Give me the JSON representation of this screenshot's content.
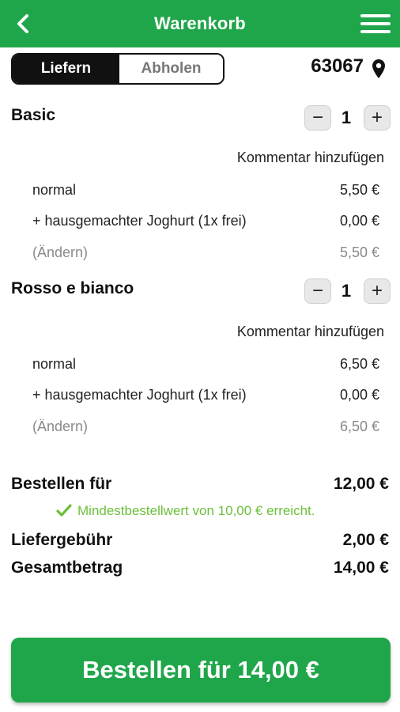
{
  "header": {
    "title": "Warenkorb",
    "back_icon": "chevron-left-icon",
    "menu_icon": "hamburger-menu-icon"
  },
  "mode": {
    "deliver_label": "Liefern",
    "pickup_label": "Abholen",
    "selected": "Liefern"
  },
  "location": {
    "zip": "63067",
    "icon": "location-pin-icon"
  },
  "items": [
    {
      "name": "Basic",
      "quantity": "1",
      "comment_label": "Kommentar hinzufügen",
      "rows": [
        {
          "label": "normal",
          "price": "5,50 €"
        },
        {
          "label": "+ hausgemachter Joghurt (1x frei)",
          "price": "0,00 €"
        },
        {
          "label": "(Ändern)",
          "price": "5,50 €"
        }
      ]
    },
    {
      "name": "Rosso e bianco",
      "quantity": "1",
      "comment_label": "Kommentar hinzufügen",
      "rows": [
        {
          "label": "normal",
          "price": "6,50 €"
        },
        {
          "label": "+ hausgemachter Joghurt (1x frei)",
          "price": "0,00 €"
        },
        {
          "label": "(Ändern)",
          "price": "6,50 €"
        }
      ]
    }
  ],
  "summary": {
    "order_for_label": "Bestellen für",
    "order_for_value": "12,00 €",
    "min_order_notice": "Mindestbestellwert von 10,00 € erreicht.",
    "delivery_fee_label": "Liefergebühr",
    "delivery_fee_value": "2,00 €",
    "total_label": "Gesamtbetrag",
    "total_value": "14,00 €"
  },
  "cta": {
    "label": "Bestellen für 14,00 €"
  },
  "colors": {
    "brand": "#1fa64a",
    "success": "#6cbf3a"
  }
}
